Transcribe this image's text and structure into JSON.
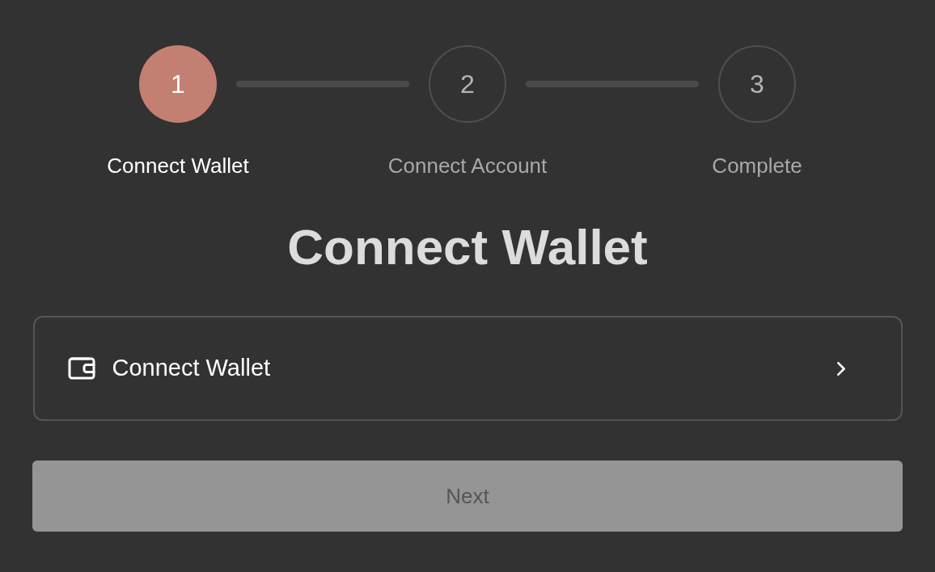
{
  "steps": [
    {
      "number": "1",
      "label": "Connect Wallet",
      "selected": true
    },
    {
      "number": "2",
      "label": "Connect Account",
      "selected": false
    },
    {
      "number": "3",
      "label": "Complete",
      "selected": false
    }
  ],
  "heading": "Connect Wallet",
  "option": {
    "label": "Connect Wallet"
  },
  "next_button": {
    "label": "Next",
    "disabled": true
  }
}
